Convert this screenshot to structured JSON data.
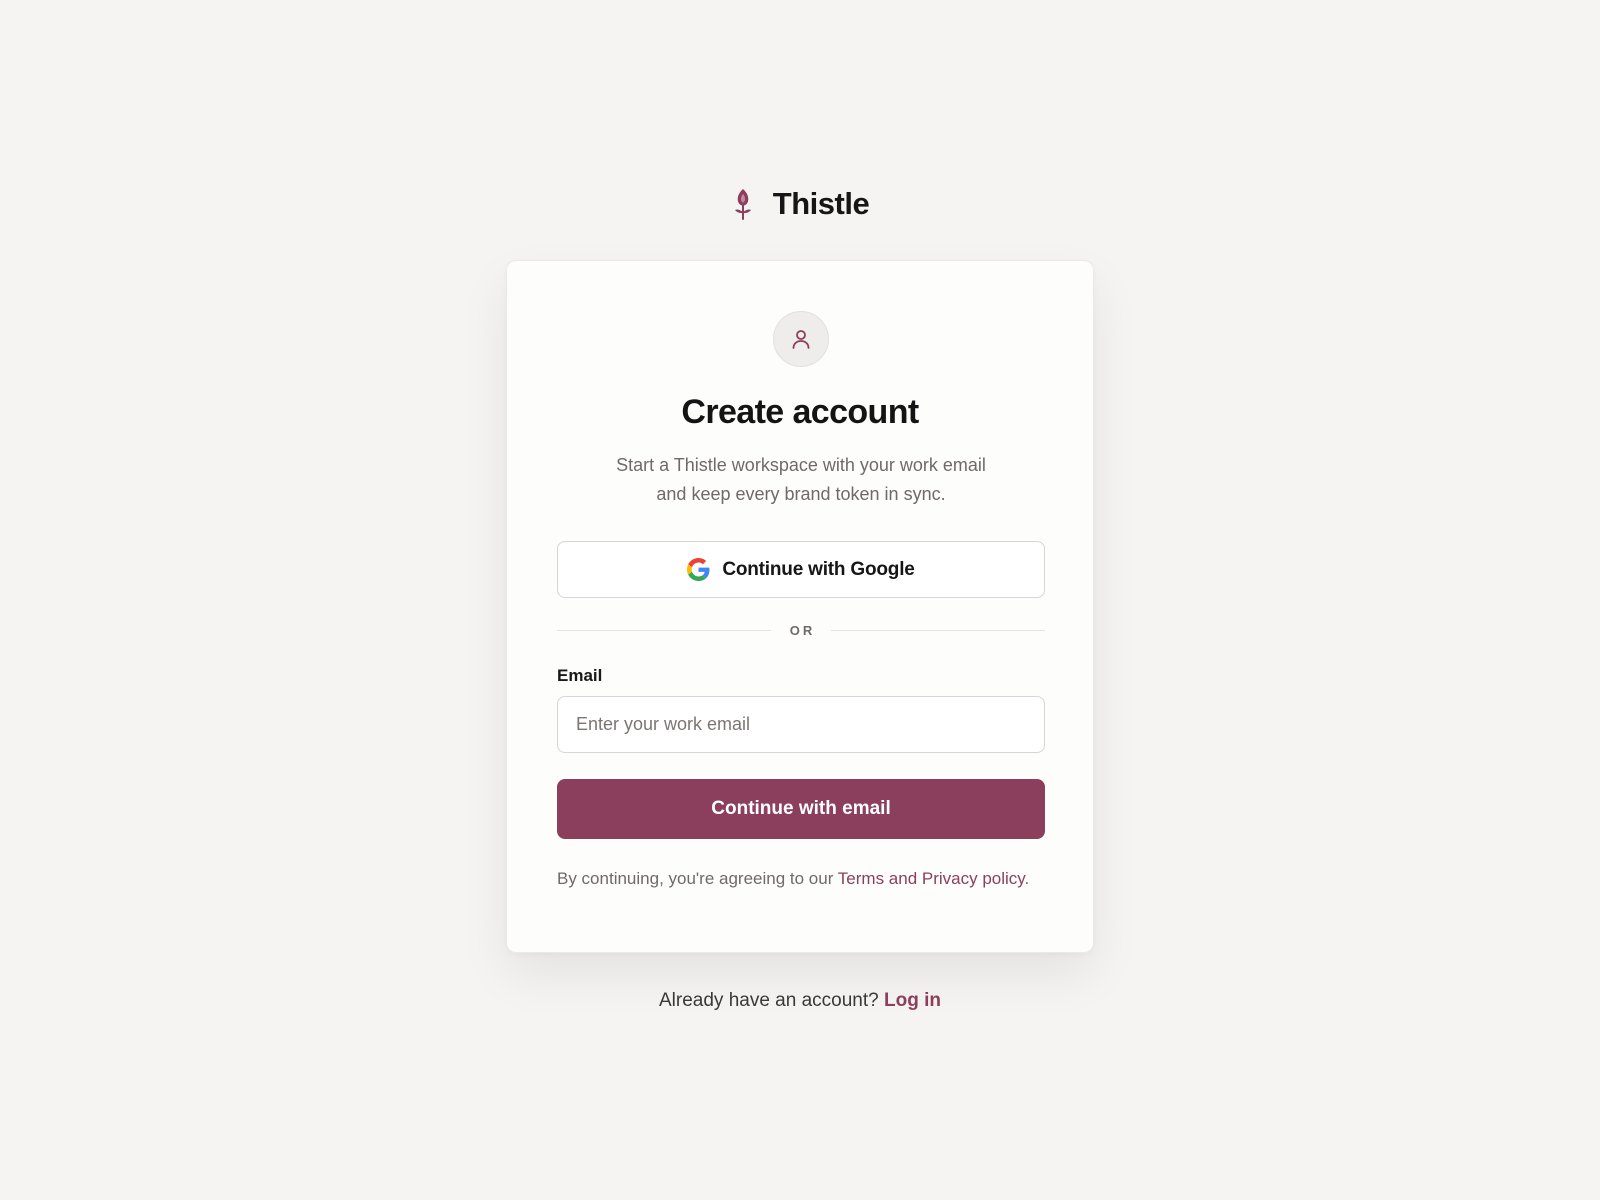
{
  "brand": {
    "name": "Thistle",
    "logo_icon": "thistle-flower-icon"
  },
  "card": {
    "avatar_icon": "user-icon",
    "title": "Create account",
    "subtitle": "Start a Thistle workspace with your work email and keep every brand token in sync.",
    "google_button": {
      "icon": "google-icon",
      "label": "Continue with Google"
    },
    "divider_text": "OR",
    "email": {
      "label": "Email",
      "value": "",
      "placeholder": "Enter your work email"
    },
    "submit_label": "Continue with email",
    "legal": {
      "prefix": "By continuing, you're agreeing to our ",
      "link_text": "Terms and Privacy policy",
      "suffix": "."
    }
  },
  "footer": {
    "prompt": "Already have an account? ",
    "login_link": "Log in"
  },
  "colors": {
    "accent": "#8b3f5c",
    "background": "#f5f4f3",
    "card": "#fdfdfc",
    "muted_text": "#6f6a68"
  }
}
